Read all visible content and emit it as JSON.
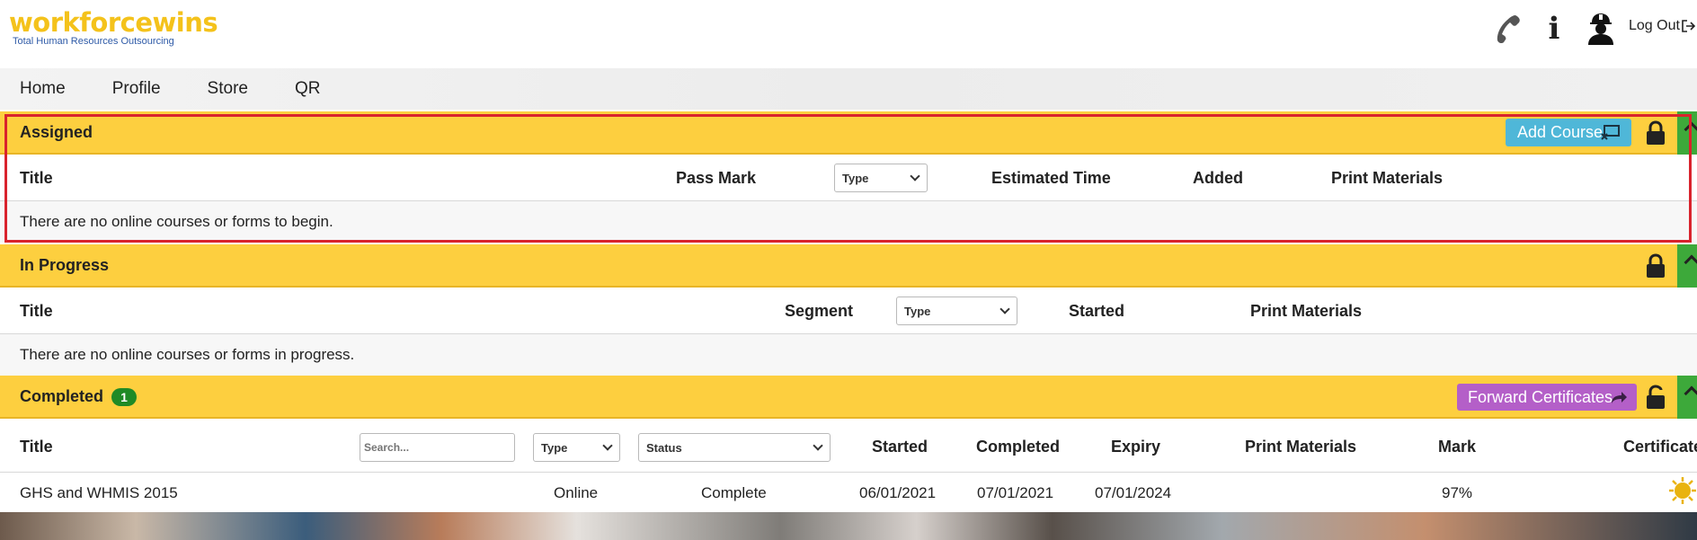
{
  "header": {
    "logo_main": "workforcewins",
    "logo_tagline": "Total Human Resources Outsourcing",
    "icons": [
      "phone-icon",
      "info-icon",
      "worker-icon"
    ],
    "info_glyph": "i",
    "logout_label": "Log Out"
  },
  "nav": {
    "items": [
      "Home",
      "Profile",
      "Store",
      "QR"
    ]
  },
  "assigned": {
    "title": "Assigned",
    "add_course_label": "Add Course",
    "columns": {
      "title": "Title",
      "pass_mark": "Pass Mark",
      "type_select": "Type",
      "estimated_time": "Estimated Time",
      "added": "Added",
      "print_materials": "Print Materials"
    },
    "empty_message": "There are no online courses or forms to begin."
  },
  "in_progress": {
    "title": "In Progress",
    "columns": {
      "title": "Title",
      "segment": "Segment",
      "type_select": "Type",
      "started": "Started",
      "print_materials": "Print Materials"
    },
    "empty_message": "There are no online courses or forms in progress."
  },
  "completed": {
    "title": "Completed",
    "count": "1",
    "forward_label": "Forward Certificates",
    "search_placeholder": "Search...",
    "type_select": "Type",
    "status_select": "Status",
    "columns": {
      "title": "Title",
      "started": "Started",
      "completed": "Completed",
      "expiry": "Expiry",
      "print_materials": "Print Materials",
      "mark": "Mark",
      "certificate": "Certificate"
    },
    "rows": [
      {
        "title": "GHS and WHMIS 2015",
        "type": "Online",
        "status": "Complete",
        "started": "06/01/2021",
        "completed": "07/01/2021",
        "expiry": "07/01/2024",
        "mark": "97%"
      }
    ]
  },
  "colors": {
    "section_header": "#fdcf3f",
    "add_course_button": "#4fb7d8",
    "forward_button": "#b45fc8",
    "badge": "#1f8a26",
    "collapse_tab": "#3da93a",
    "highlight_border": "#d9232d",
    "logo": "#f4c21b"
  }
}
